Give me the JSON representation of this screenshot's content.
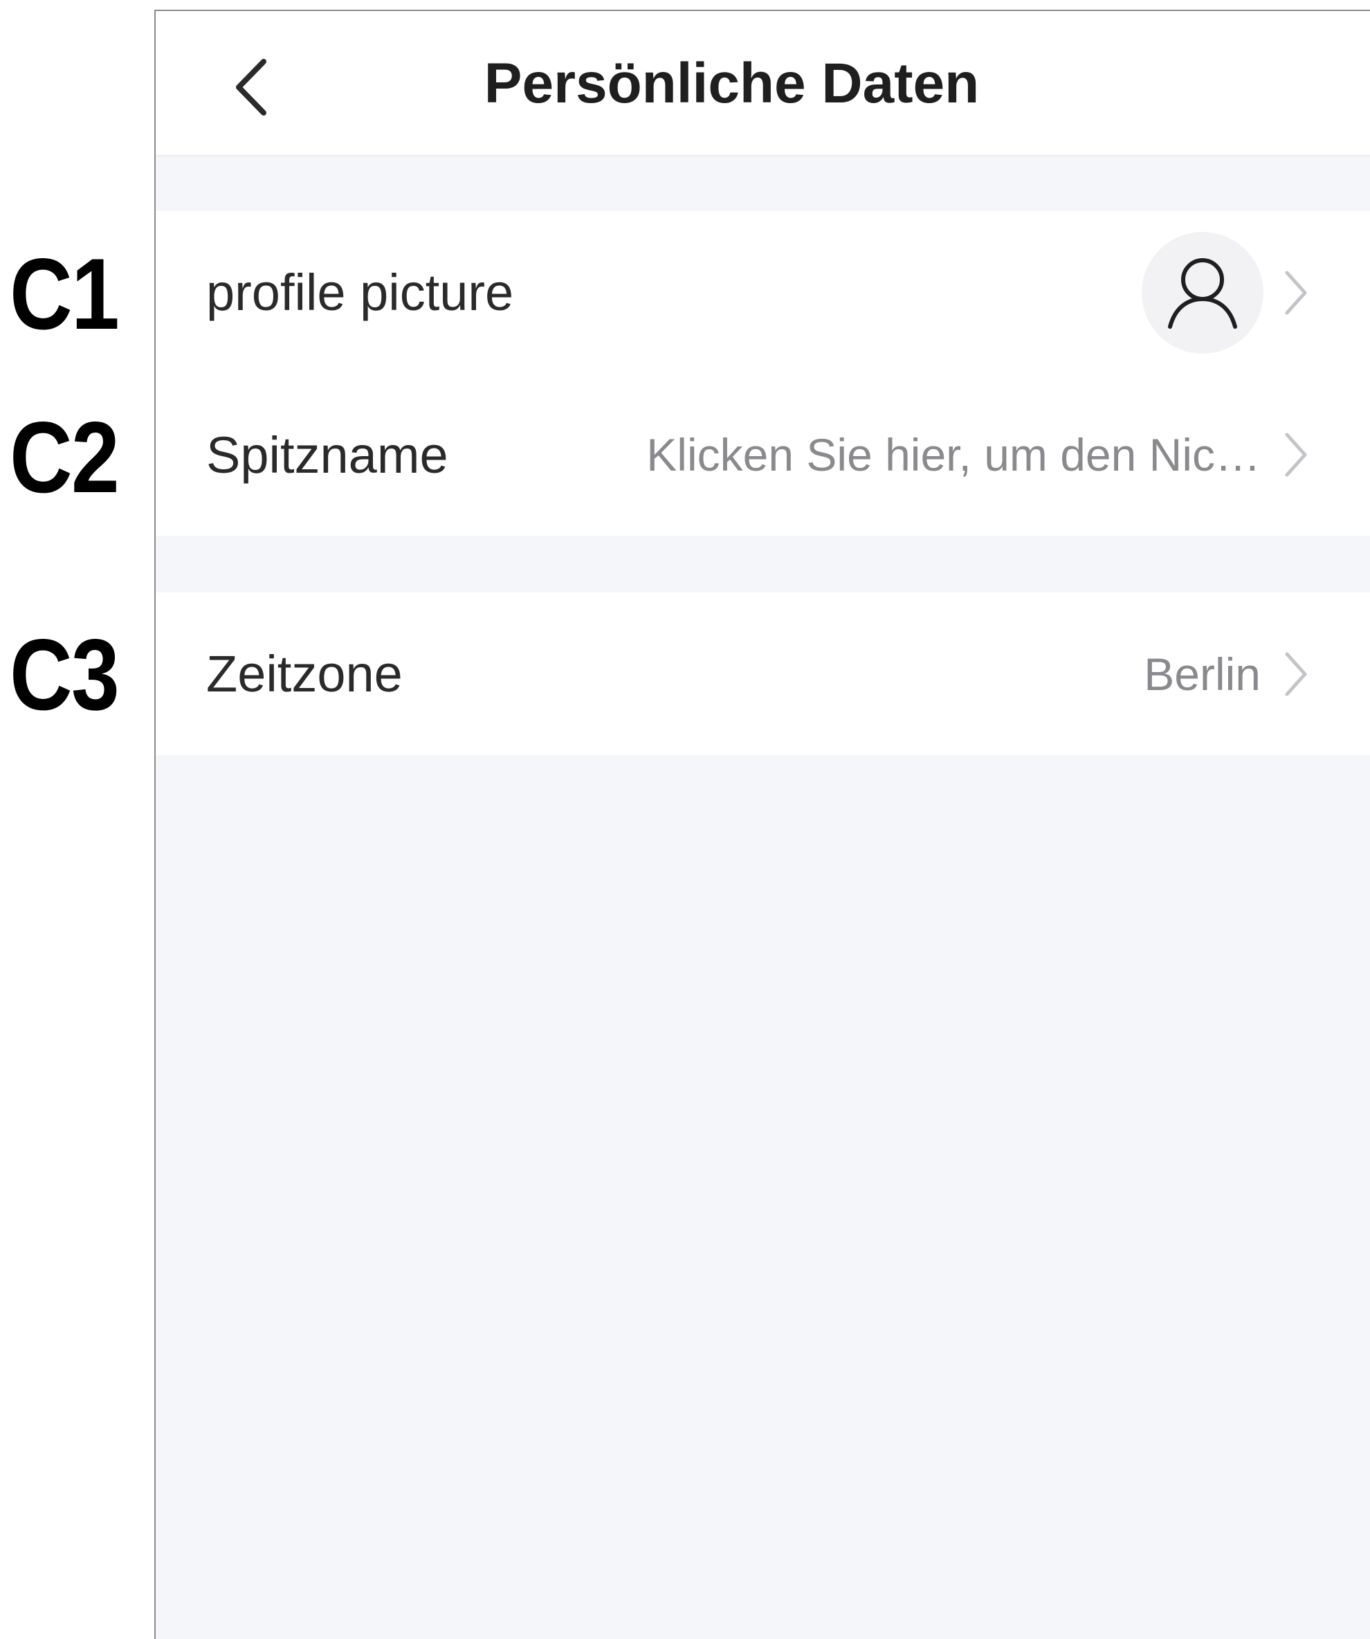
{
  "annotations": {
    "c1": "C1",
    "c2": "C2",
    "c3": "C3"
  },
  "header": {
    "title": "Persönliche Daten",
    "back_icon": "chevron-left-icon"
  },
  "rows": {
    "profile_picture": {
      "label": "profile picture",
      "avatar_icon": "user-icon",
      "chevron_icon": "chevron-right-icon"
    },
    "nickname": {
      "label": "Spitzname",
      "value": "Klicken Sie hier, um den Nic…",
      "chevron_icon": "chevron-right-icon"
    },
    "timezone": {
      "label": "Zeitzone",
      "value": "Berlin",
      "chevron_icon": "chevron-right-icon"
    }
  },
  "colors": {
    "page_background": "#f5f6f9",
    "card_background": "#ffffff",
    "title_text": "#1f1f1f",
    "label_text": "#2a2a2a",
    "secondary_text": "#8a8a8e",
    "chevron": "#c4c4c8"
  }
}
